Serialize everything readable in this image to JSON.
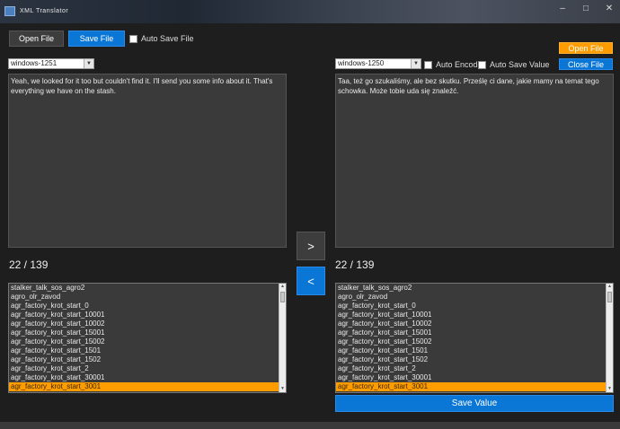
{
  "window": {
    "title": "XML Translator",
    "minimize": "–",
    "maximize": "□",
    "close": "✕"
  },
  "toolbar": {
    "open_label": "Open File",
    "save_label": "Save File",
    "auto_save_label": "Auto Save File"
  },
  "right_buttons": {
    "open_label": "Open File",
    "close_label": "Close File"
  },
  "left": {
    "encoding": "windows-1251",
    "text": "Yeah, we looked for it too but couldn't find it. I'll send you some info about it. That's everything we have on the stash.",
    "counter": "22 / 139"
  },
  "right": {
    "encoding": "windows-1250",
    "auto_encode_label": "Auto Encode",
    "auto_save_value_label": "Auto Save Value",
    "text": "Taa, też go szukaliśmy, ale bez skutku. Prześlę ci dane, jakie mamy na temat tego schowka. Może tobie uda się znaleźć.",
    "counter": "22 / 139",
    "save_value_label": "Save Value"
  },
  "arrows": {
    "forward": ">",
    "back": "<"
  },
  "list_items": [
    "stalker_talk_sos_agro2",
    "agro_olr_zavod",
    "agr_factory_krot_start_0",
    "agr_factory_krot_start_10001",
    "agr_factory_krot_start_10002",
    "agr_factory_krot_start_15001",
    "agr_factory_krot_start_15002",
    "agr_factory_krot_start_1501",
    "agr_factory_krot_start_1502",
    "agr_factory_krot_start_2",
    "agr_factory_krot_start_30001",
    "agr_factory_krot_start_3001"
  ],
  "selected_index": 11,
  "colors": {
    "accent_blue": "#0a76d6",
    "accent_orange": "#ff9c00",
    "background": "#1e1e1e"
  }
}
